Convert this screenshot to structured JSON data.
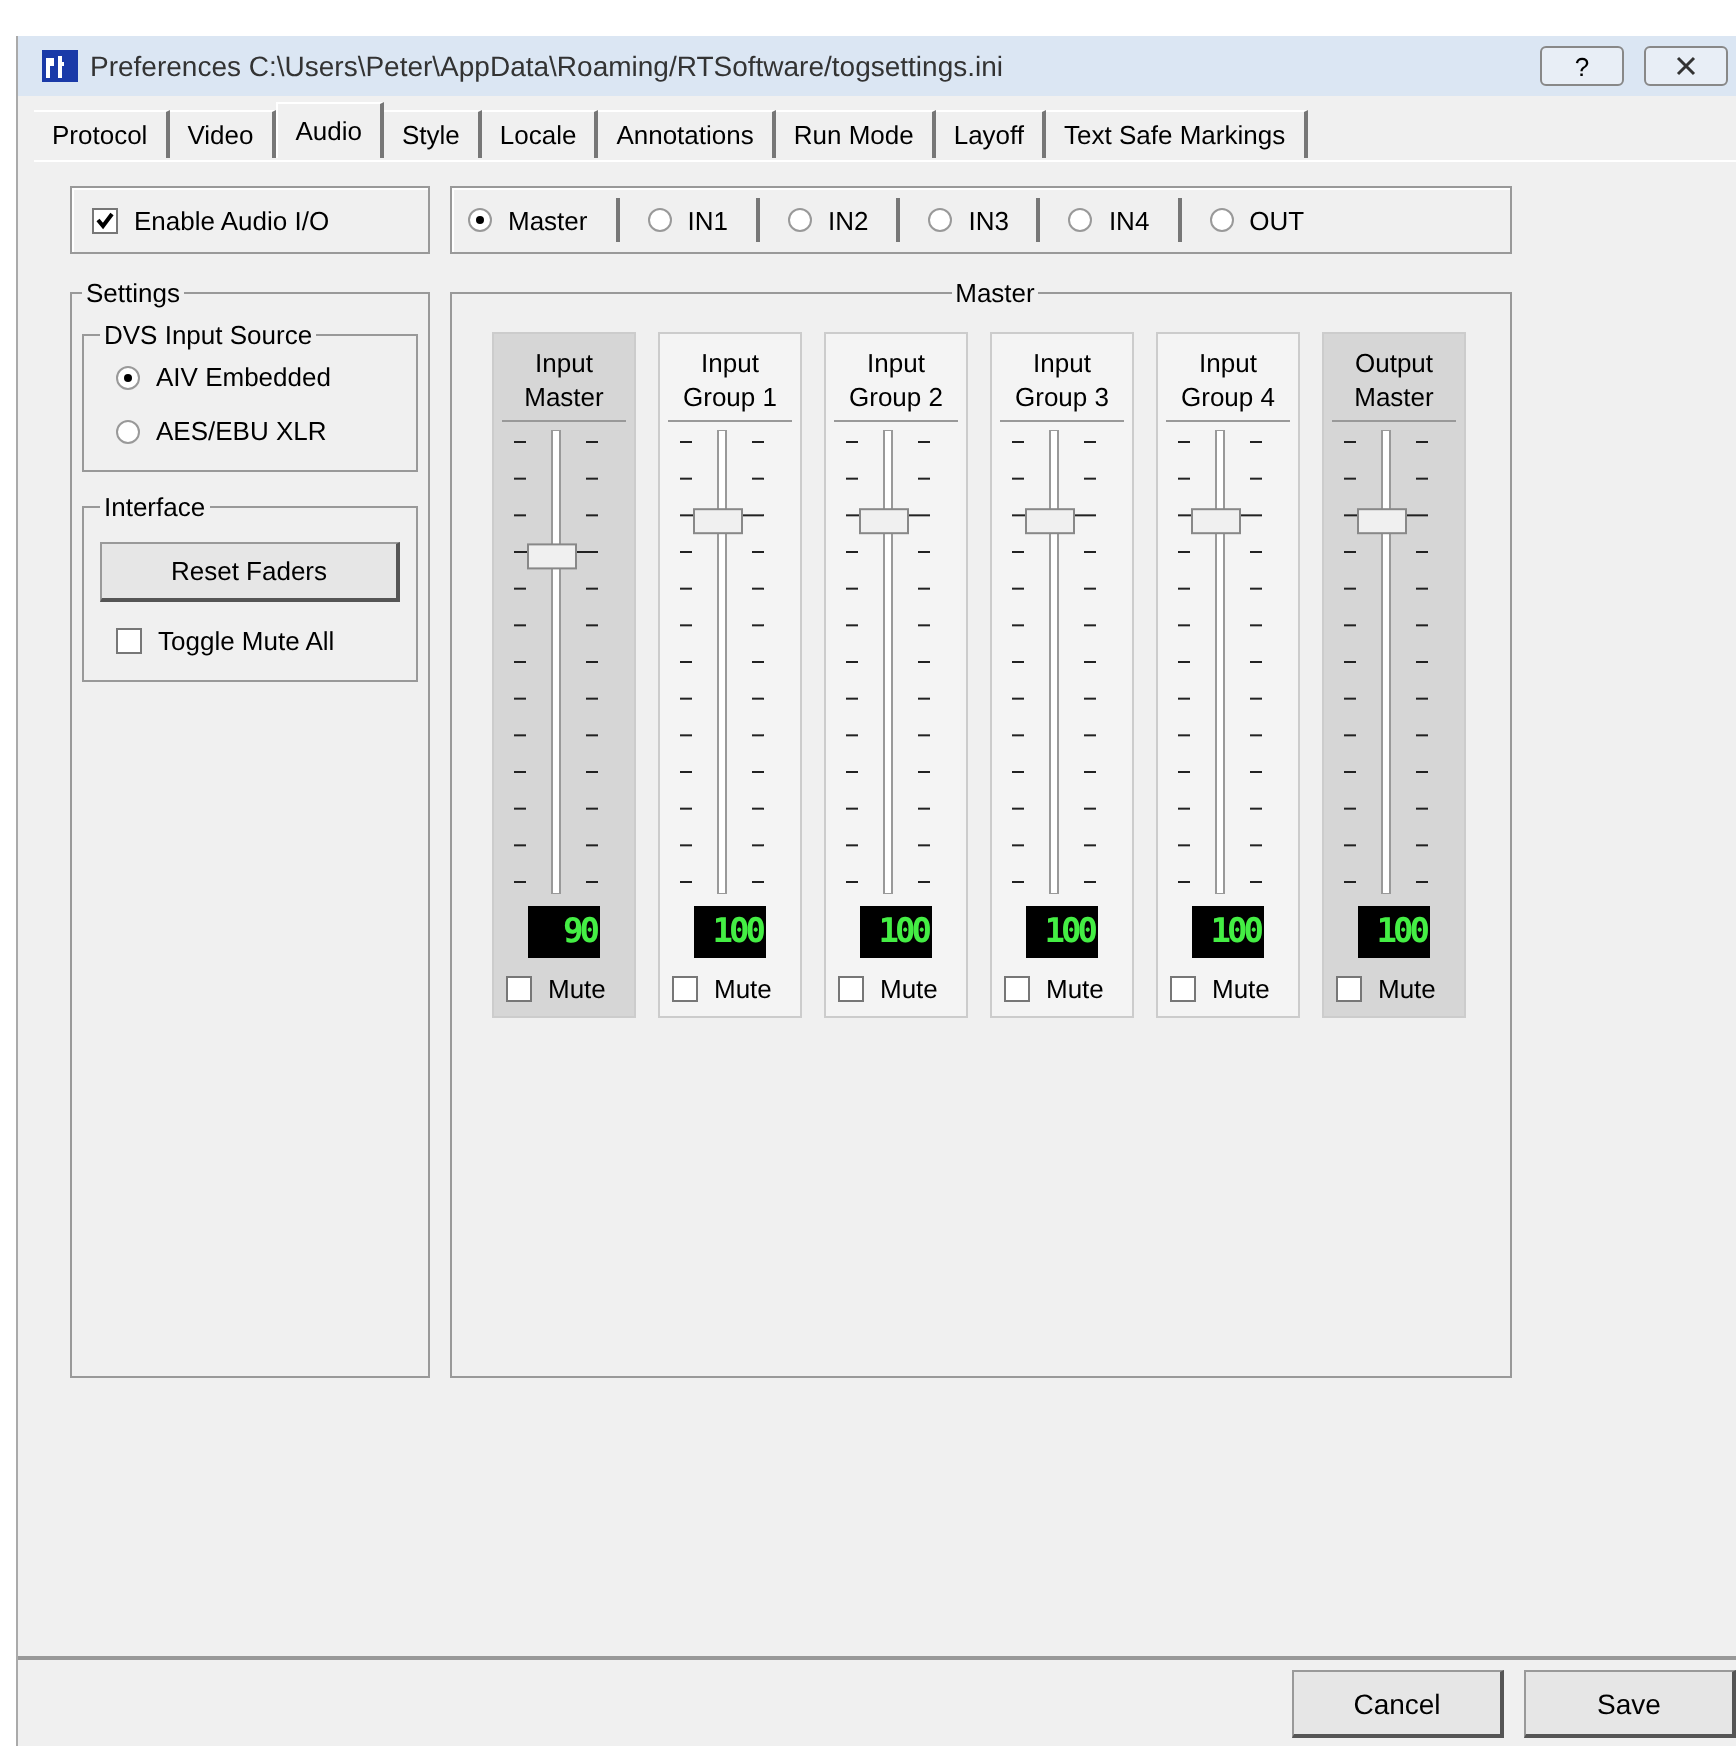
{
  "window": {
    "title": "Preferences C:\\Users\\Peter\\AppData\\Roaming/RTSoftware/togsettings.ini",
    "help": "?"
  },
  "tabs": [
    {
      "label": "Protocol",
      "selected": false
    },
    {
      "label": "Video",
      "selected": false
    },
    {
      "label": "Audio",
      "selected": true
    },
    {
      "label": "Style",
      "selected": false
    },
    {
      "label": "Locale",
      "selected": false
    },
    {
      "label": "Annotations",
      "selected": false
    },
    {
      "label": "Run Mode",
      "selected": false
    },
    {
      "label": "Layoff",
      "selected": false
    },
    {
      "label": "Text Safe Markings",
      "selected": false
    }
  ],
  "enable_audio": {
    "label": "Enable Audio I/O",
    "checked": true
  },
  "channel_selector": [
    {
      "label": "Master",
      "selected": true
    },
    {
      "label": "IN1",
      "selected": false
    },
    {
      "label": "IN2",
      "selected": false
    },
    {
      "label": "IN3",
      "selected": false
    },
    {
      "label": "IN4",
      "selected": false
    },
    {
      "label": "OUT",
      "selected": false
    }
  ],
  "settings": {
    "title": "Settings",
    "dvs_input_source": {
      "title": "DVS Input Source",
      "options": [
        {
          "label": "AIV Embedded",
          "selected": true
        },
        {
          "label": "AES/EBU XLR",
          "selected": false
        }
      ]
    },
    "interface": {
      "title": "Interface",
      "reset_button": "Reset Faders",
      "toggle_mute_all": {
        "label": "Toggle Mute All",
        "checked": false
      }
    }
  },
  "master": {
    "title": "Master",
    "faders": [
      {
        "label": "Input Master",
        "level": 0.74,
        "display": "90",
        "mute_label": "Mute",
        "muted": false,
        "highlighted": true
      },
      {
        "label": "Input Group 1",
        "level": 0.82,
        "display": "100",
        "mute_label": "Mute",
        "muted": false,
        "highlighted": false
      },
      {
        "label": "Input Group 2",
        "level": 0.82,
        "display": "100",
        "mute_label": "Mute",
        "muted": false,
        "highlighted": false
      },
      {
        "label": "Input Group 3",
        "level": 0.82,
        "display": "100",
        "mute_label": "Mute",
        "muted": false,
        "highlighted": false
      },
      {
        "label": "Input Group 4",
        "level": 0.82,
        "display": "100",
        "mute_label": "Mute",
        "muted": false,
        "highlighted": false
      },
      {
        "label": "Output Master",
        "level": 0.82,
        "display": "100",
        "mute_label": "Mute",
        "muted": false,
        "highlighted": true
      }
    ]
  },
  "buttons": [
    "Cancel",
    "Save"
  ]
}
